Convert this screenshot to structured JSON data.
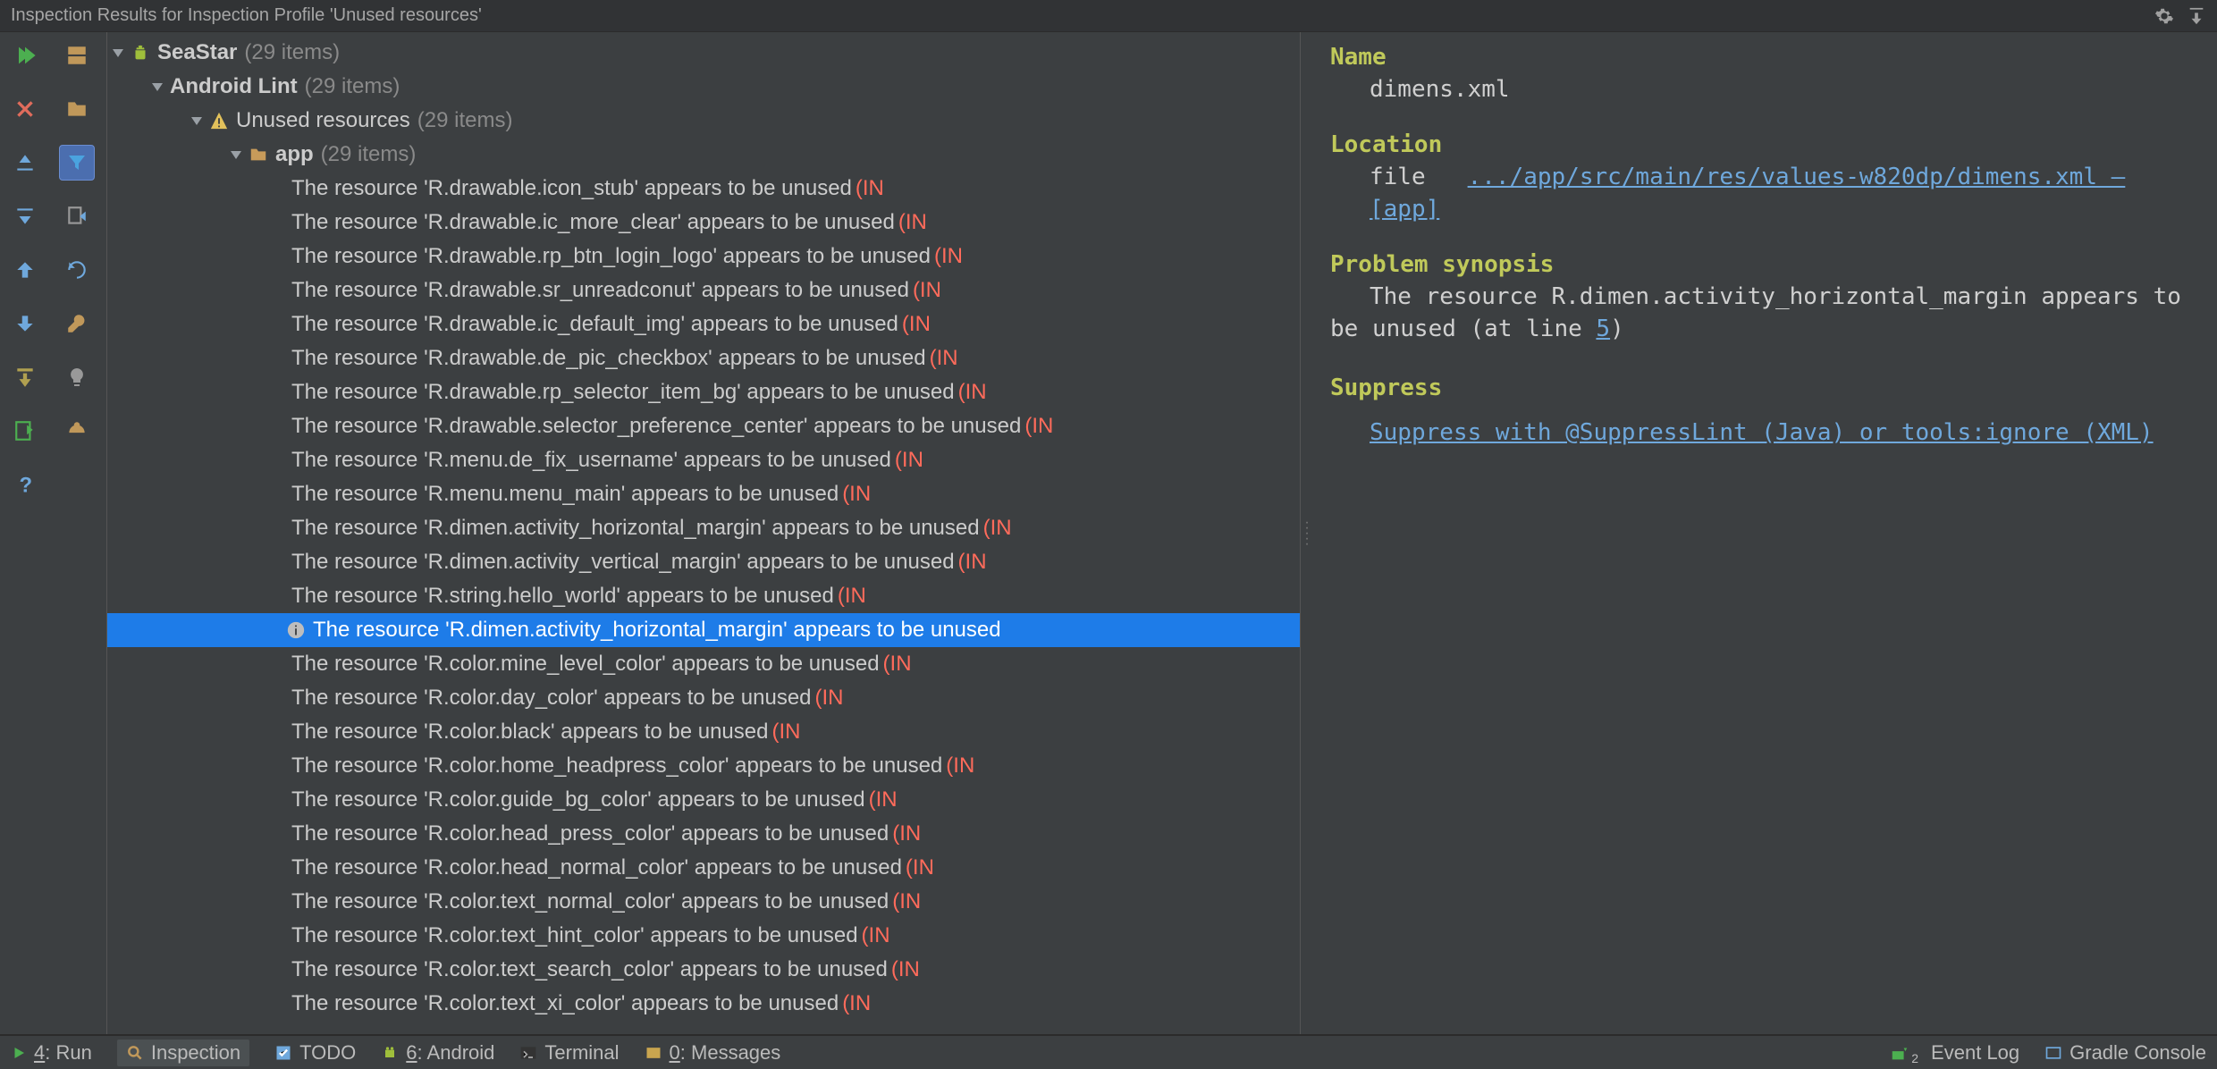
{
  "title": "Inspection Results for Inspection Profile 'Unused resources'",
  "tree": {
    "root": {
      "label": "SeaStar",
      "count": "(29 items)"
    },
    "lint": {
      "label": "Android Lint",
      "count": "(29 items)"
    },
    "category": {
      "label": "Unused resources",
      "count": "(29 items)"
    },
    "module": {
      "label": "app",
      "count": "(29 items)"
    },
    "items": [
      {
        "text": "The resource 'R.drawable.icon_stub' appears to be unused",
        "in": "(IN"
      },
      {
        "text": "The resource 'R.drawable.ic_more_clear' appears to be unused",
        "in": "(IN"
      },
      {
        "text": "The resource 'R.drawable.rp_btn_login_logo' appears to be unused",
        "in": "(IN"
      },
      {
        "text": "The resource 'R.drawable.sr_unreadconut' appears to be unused",
        "in": "(IN"
      },
      {
        "text": "The resource 'R.drawable.ic_default_img' appears to be unused",
        "in": "(IN"
      },
      {
        "text": "The resource 'R.drawable.de_pic_checkbox' appears to be unused",
        "in": "(IN"
      },
      {
        "text": "The resource 'R.drawable.rp_selector_item_bg' appears to be unused",
        "in": "(IN"
      },
      {
        "text": "The resource 'R.drawable.selector_preference_center' appears to be unused",
        "in": "(IN"
      },
      {
        "text": "The resource 'R.menu.de_fix_username' appears to be unused",
        "in": "(IN"
      },
      {
        "text": "The resource 'R.menu.menu_main' appears to be unused",
        "in": "(IN"
      },
      {
        "text": "The resource 'R.dimen.activity_horizontal_margin' appears to be unused",
        "in": "(IN"
      },
      {
        "text": "The resource 'R.dimen.activity_vertical_margin' appears to be unused",
        "in": "(IN"
      },
      {
        "text": "The resource 'R.string.hello_world' appears to be unused",
        "in": "(IN"
      },
      {
        "text": "The resource 'R.dimen.activity_horizontal_margin' appears to be unused",
        "in": "",
        "selected": true
      },
      {
        "text": "The resource 'R.color.mine_level_color' appears to be unused",
        "in": "(IN"
      },
      {
        "text": "The resource 'R.color.day_color' appears to be unused",
        "in": "(IN"
      },
      {
        "text": "The resource 'R.color.black' appears to be unused",
        "in": "(IN"
      },
      {
        "text": "The resource 'R.color.home_headpress_color' appears to be unused",
        "in": "(IN"
      },
      {
        "text": "The resource 'R.color.guide_bg_color' appears to be unused",
        "in": "(IN"
      },
      {
        "text": "The resource 'R.color.head_press_color' appears to be unused",
        "in": "(IN"
      },
      {
        "text": "The resource 'R.color.head_normal_color' appears to be unused",
        "in": "(IN"
      },
      {
        "text": "The resource 'R.color.text_normal_color' appears to be unused",
        "in": "(IN"
      },
      {
        "text": "The resource 'R.color.text_hint_color' appears to be unused",
        "in": "(IN"
      },
      {
        "text": "The resource 'R.color.text_search_color' appears to be unused",
        "in": "(IN"
      },
      {
        "text": "The resource 'R.color.text_xi_color' appears to be unused",
        "in": "(IN"
      }
    ]
  },
  "detail": {
    "name_label": "Name",
    "name_value": "dimens.xml",
    "location_label": "Location",
    "location_prefix": "file",
    "location_link": ".../app/src/main/res/values-w820dp/dimens.xml  –  [app]",
    "problem_label": "Problem synopsis",
    "problem_text_pre": "The resource R.dimen.activity_horizontal_margin appears to be unused (at line ",
    "problem_line": "5",
    "problem_text_post": ")",
    "suppress_label": "Suppress",
    "suppress_link": "Suppress with @SuppressLint (Java) or tools:ignore (XML)"
  },
  "status": {
    "run": "4: Run",
    "inspection": "Inspection",
    "todo": "TODO",
    "android": "6: Android",
    "terminal": "Terminal",
    "messages": "0: Messages",
    "eventlog": "Event Log",
    "eventlog_count": "2",
    "gradle": "Gradle Console"
  }
}
